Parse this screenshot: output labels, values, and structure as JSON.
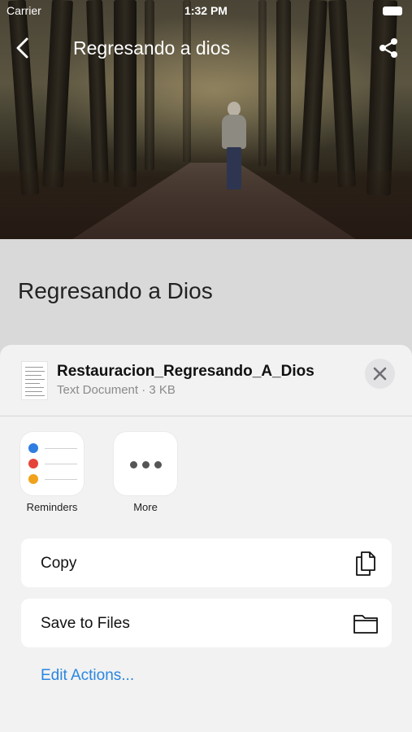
{
  "status_bar": {
    "carrier": "Carrier",
    "time": "1:32 PM"
  },
  "nav": {
    "title": "Regresando a dios",
    "back_icon": "chevron-left-icon",
    "share_icon": "share-icon"
  },
  "page": {
    "heading": "Regresando a Dios"
  },
  "share_sheet": {
    "file_name": "Restauracion_Regresando_A_Dios",
    "file_meta": "Text Document · 3 KB",
    "apps": [
      {
        "label": "Reminders",
        "icon": "reminders-icon"
      },
      {
        "label": "More",
        "icon": "more-icon"
      }
    ],
    "actions": [
      {
        "label": "Copy",
        "icon": "copy-icon"
      },
      {
        "label": "Save to Files",
        "icon": "folder-icon"
      }
    ],
    "edit_actions": "Edit Actions...",
    "reminder_colors": [
      "#2f7de1",
      "#e5443a",
      "#f0a21c"
    ]
  }
}
